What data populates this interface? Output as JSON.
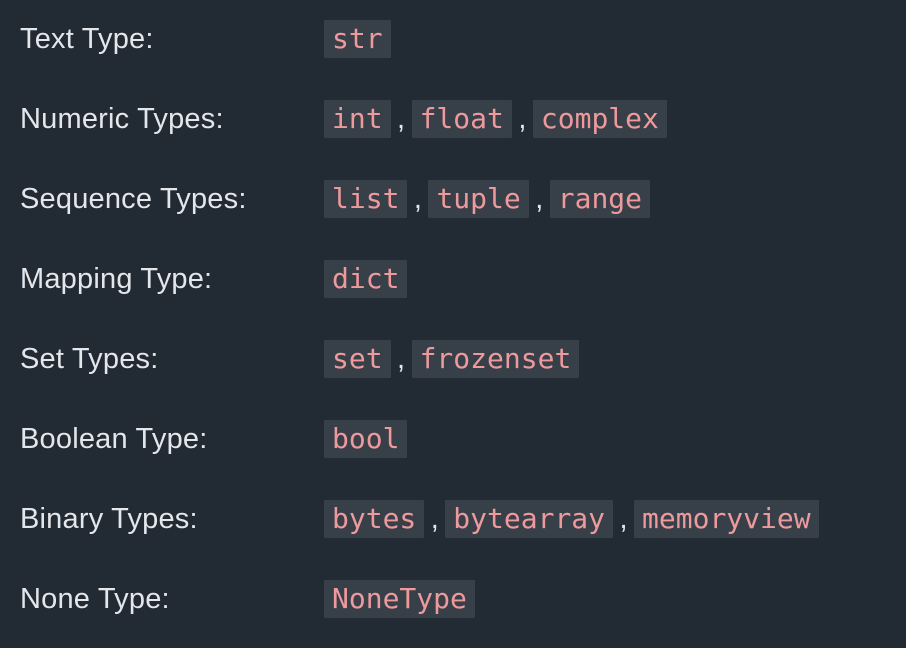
{
  "rows": [
    {
      "label": "Text Type:",
      "values": [
        "str"
      ]
    },
    {
      "label": "Numeric Types:",
      "values": [
        "int",
        "float",
        "complex"
      ]
    },
    {
      "label": "Sequence Types:",
      "values": [
        "list",
        "tuple",
        "range"
      ]
    },
    {
      "label": "Mapping Type:",
      "values": [
        "dict"
      ]
    },
    {
      "label": "Set Types:",
      "values": [
        "set",
        "frozenset"
      ]
    },
    {
      "label": "Boolean Type:",
      "values": [
        "bool"
      ]
    },
    {
      "label": "Binary Types:",
      "values": [
        "bytes",
        "bytearray",
        "memoryview"
      ]
    },
    {
      "label": "None Type:",
      "values": [
        "NoneType"
      ]
    }
  ],
  "separator": ",",
  "colors": {
    "background": "#222a33",
    "text": "#e3e6ea",
    "code_background": "#373f49",
    "code_text": "#ee9a9c"
  }
}
